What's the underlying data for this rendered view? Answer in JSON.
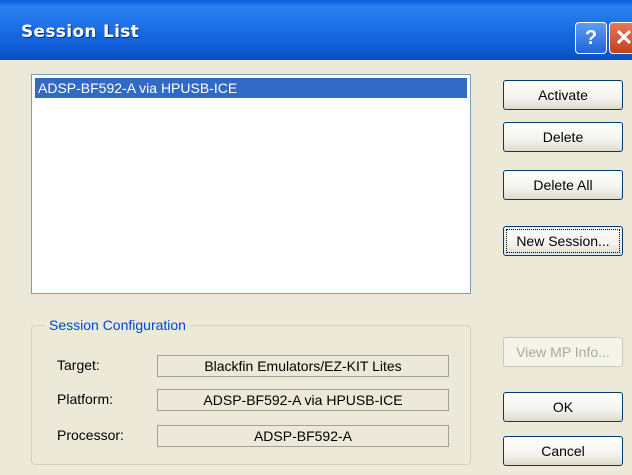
{
  "window": {
    "title": "Session List",
    "help_glyph": "?",
    "close_glyph": "✕"
  },
  "sessions": [
    "ADSP-BF592-A via HPUSB-ICE"
  ],
  "buttons": {
    "activate": "Activate",
    "delete": "Delete",
    "delete_all": "Delete All",
    "new_session": "New Session...",
    "view_mp_info": "View MP Info...",
    "ok": "OK",
    "cancel": "Cancel"
  },
  "config": {
    "title": "Session Configuration",
    "target_label": "Target:",
    "target_value": "Blackfin Emulators/EZ-KIT Lites",
    "platform_label": "Platform:",
    "platform_value": "ADSP-BF592-A via HPUSB-ICE",
    "processor_label": "Processor:",
    "processor_value": "ADSP-BF592-A"
  },
  "colors": {
    "titlebar": "#1c6fe6",
    "selection": "#316ac5",
    "group_title": "#0046d5"
  }
}
